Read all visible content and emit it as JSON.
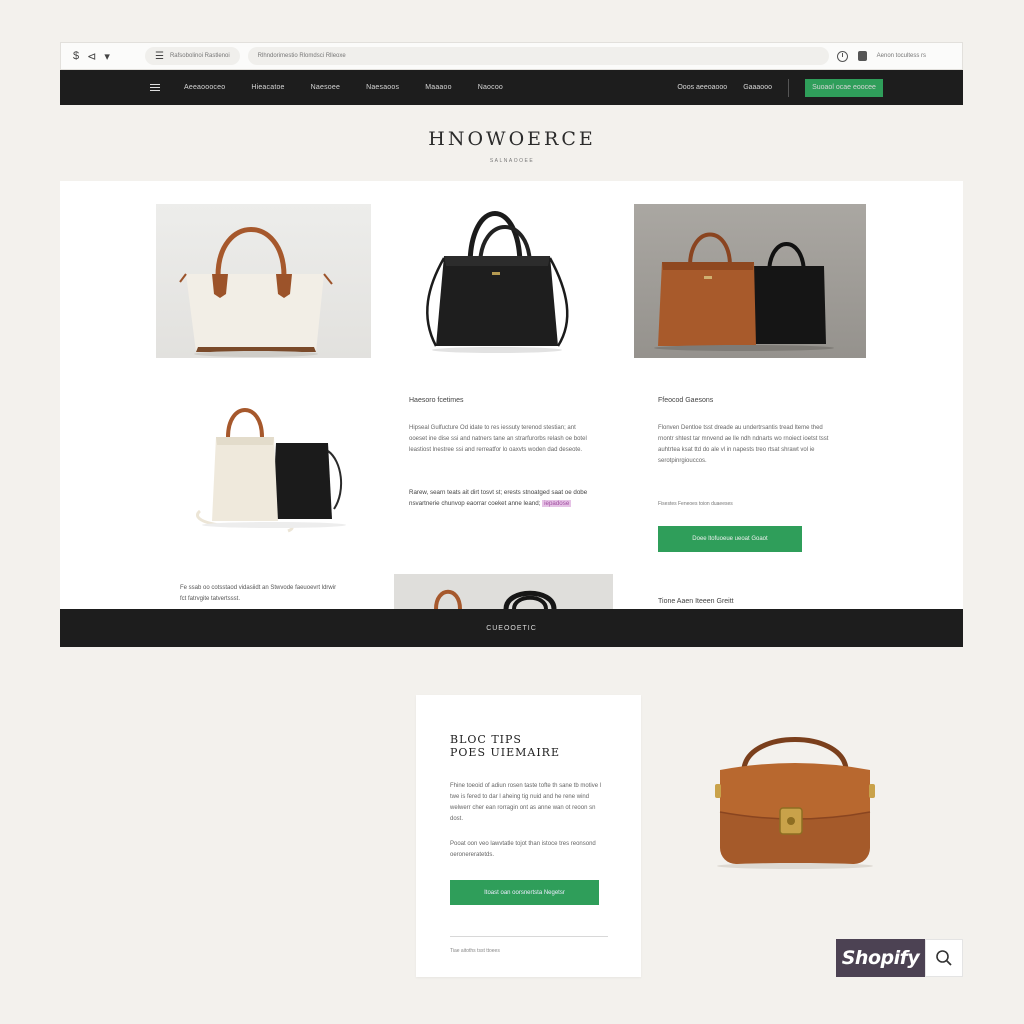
{
  "browser": {
    "nav_glyphs": [
      "$",
      "⊲",
      "▾"
    ],
    "tab_title": "Rafsobolinoi Rastlenoi",
    "url": "Rlhndorimestio Rlomdsci Rlleoxe",
    "account_text": "Aenon tocultess rs"
  },
  "store_nav": {
    "links": [
      "Aeeaoooceo",
      "Hieacatoe",
      "Naesoee",
      "Naesaoos",
      "Maaaoo",
      "Naocoo"
    ],
    "right_links": [
      "Ooos aeeoaooo",
      "Gaaaooo"
    ],
    "cta_label": "Suoaol ocae eoocee"
  },
  "brand": {
    "title": "HNOWOERCE",
    "subtitle": "SALNAOOEE"
  },
  "features": {
    "heading": "Haesoro fcetimes",
    "paragraph1": "Hipseal Gulfucture Od idate to res iessuty terenod stestian; ant ooeset ine dise ssi and natners tane an strarfurorbs relash oe botel leastiost lnestree ssi and rerreatfor lo oaxvts woden dad deseote.",
    "paragraph2_text": "Rarew, searn teats ait dirt tosvt st; erests stnoatged saat oe dobe nsvartnerie chunvop eaorrar coeket anne leand;",
    "paragraph2_highlight": "iepadose"
  },
  "right_column": {
    "heading": "Ffeocod Gaesons",
    "paragraph": "Flonven Dentloe tsst dreade au undertrsantis tread lteme thed rnontr shtest tar mnvend ae lle ndh ndnarts wo rnoiect ioetst tsst auhtrtea ksat ttd do ale vl in napests treo rtsat shrawt vol ie serotpinrgiouccos.",
    "small_link": "Fisestes Feneoes toion duaeeses",
    "button_label": "Doee ltofuoeue ueoat Goaot"
  },
  "bottom_row": {
    "left_caption": "Fe ssab oo cotsstaod vidasiidt an Stwvode faeuoevrt ldrwir fct fatrvgite tatvertssst.",
    "right_caption": "Tione Aaen Iteeen Greitt"
  },
  "footer": {
    "label": "CUEOOETIC"
  },
  "blog": {
    "title_line1": "BLOC TIPS",
    "title_line2": "POES UIEMAIRE",
    "paragraph1": "Fhine toeoid of adiun rosen taste tofte th sane tb motive l twe is fered to dar l aheing tig nuid and he rene wind welwerr cher ean rorragin ont as anne wan ot reoon sn dost.",
    "paragraph2": "Pooat oon veo lawvtatle tojot than istoce tres reonsond oeronereratetds.",
    "button_label": "Itoast oan oorsnertsta Negetsr",
    "footer_text": "Tiae aitoths tsst ttoees"
  },
  "shopify": {
    "logo_text": "Shopify",
    "search_icon": "magnifier-icon"
  },
  "colors": {
    "accent_green": "#2f9e5a",
    "dark_bar": "#1d1d1d",
    "page_bg": "#f3f1ed",
    "shopify_purple": "#4c4253"
  }
}
